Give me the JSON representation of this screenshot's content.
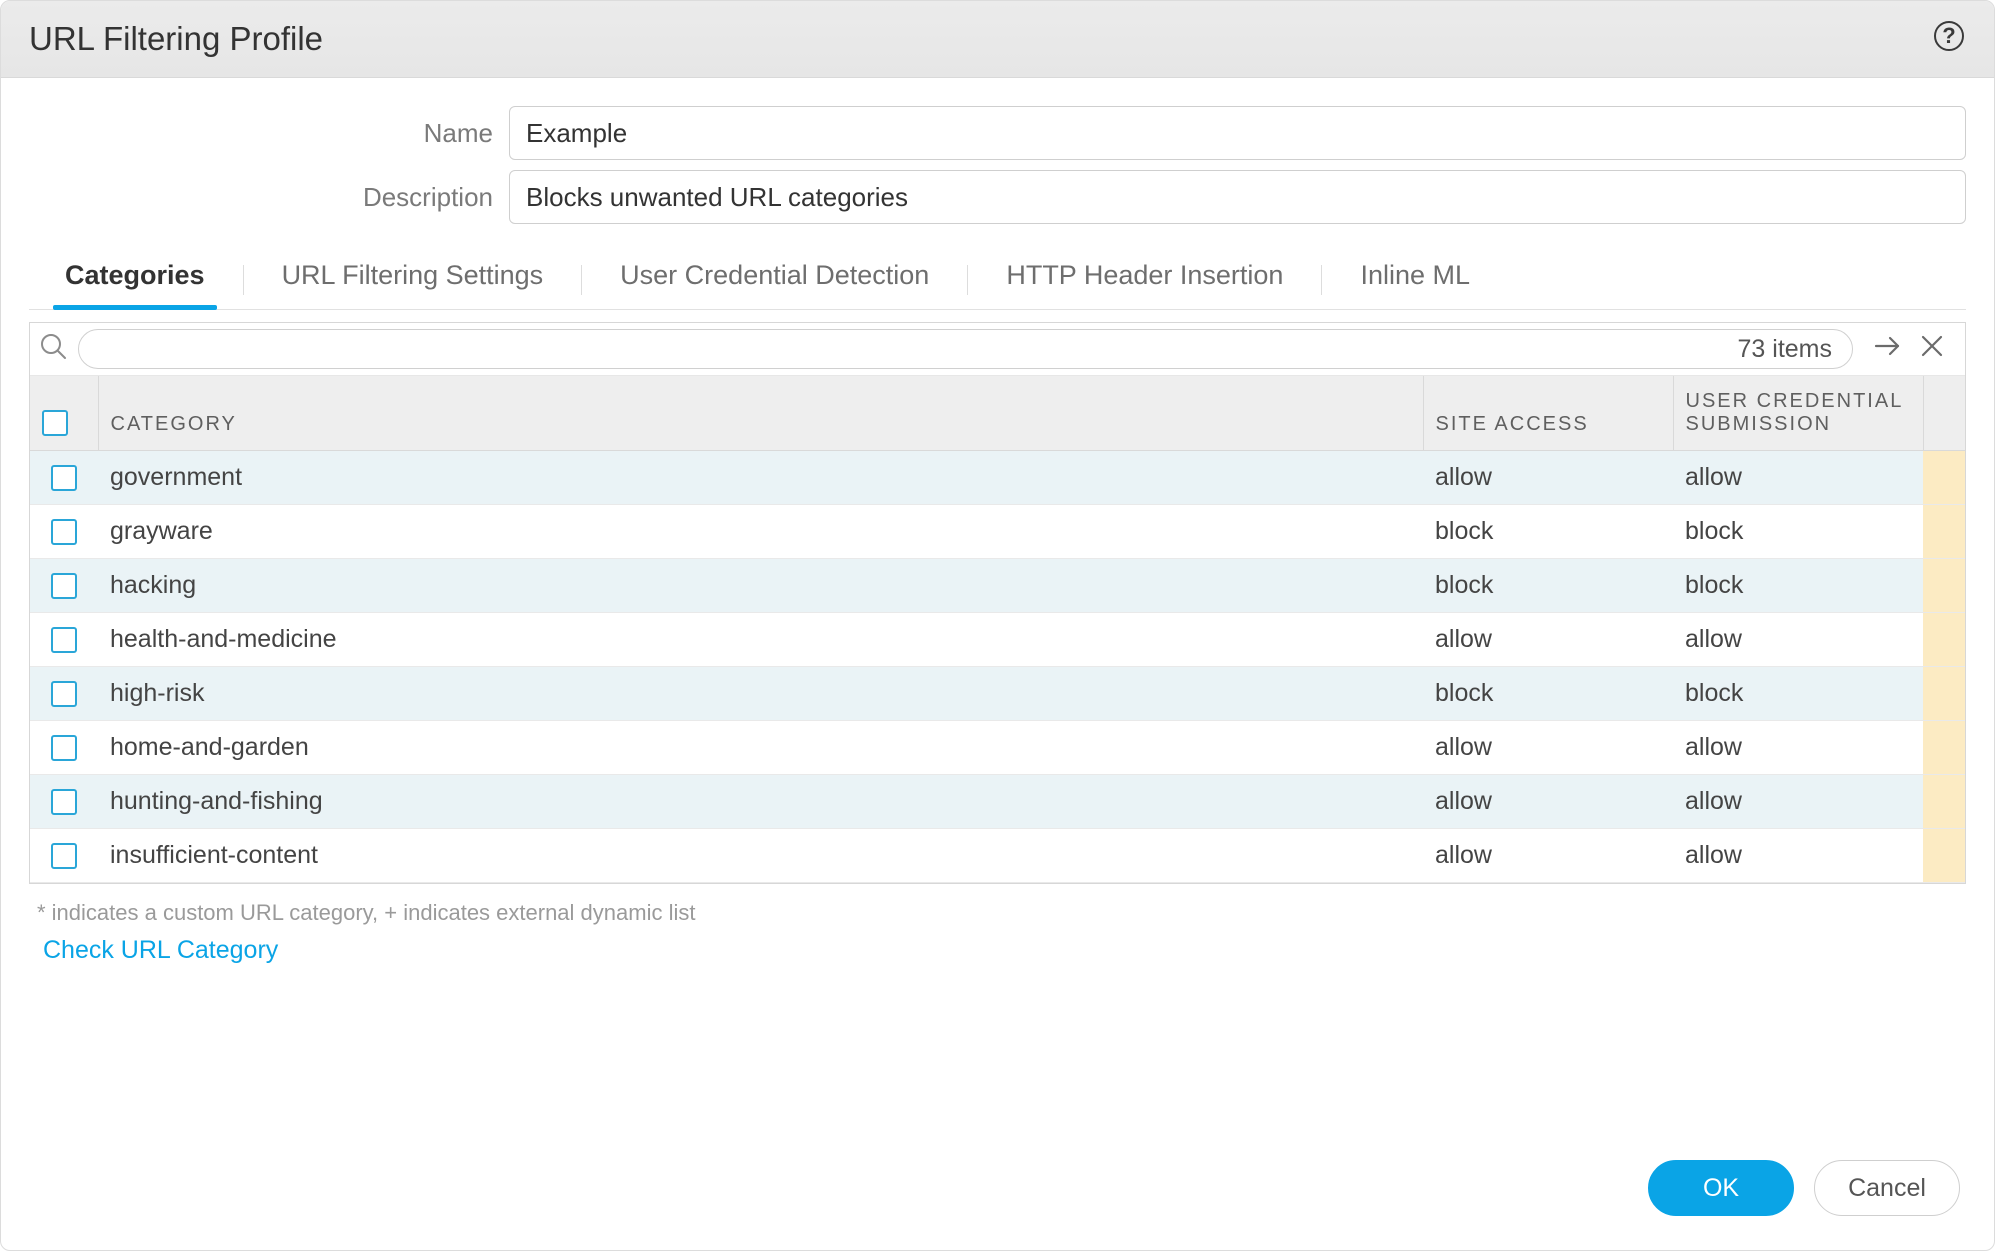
{
  "dialog": {
    "title": "URL Filtering Profile"
  },
  "form": {
    "name_label": "Name",
    "name_value": "Example",
    "desc_label": "Description",
    "desc_value": "Blocks unwanted URL categories"
  },
  "tabs": [
    {
      "label": "Categories"
    },
    {
      "label": "URL Filtering Settings"
    },
    {
      "label": "User Credential Detection"
    },
    {
      "label": "HTTP Header Insertion"
    },
    {
      "label": "Inline ML"
    }
  ],
  "grid": {
    "item_count": "73 items",
    "headers": {
      "category": "CATEGORY",
      "site_access": "SITE ACCESS",
      "user_cred": "USER CREDENTIAL SUBMISSION"
    },
    "rows": [
      {
        "category": "government",
        "site_access": "allow",
        "user_cred": "allow"
      },
      {
        "category": "grayware",
        "site_access": "block",
        "user_cred": "block"
      },
      {
        "category": "hacking",
        "site_access": "block",
        "user_cred": "block"
      },
      {
        "category": "health-and-medicine",
        "site_access": "allow",
        "user_cred": "allow"
      },
      {
        "category": "high-risk",
        "site_access": "block",
        "user_cred": "block"
      },
      {
        "category": "home-and-garden",
        "site_access": "allow",
        "user_cred": "allow"
      },
      {
        "category": "hunting-and-fishing",
        "site_access": "allow",
        "user_cred": "allow"
      },
      {
        "category": "insufficient-content",
        "site_access": "allow",
        "user_cred": "allow"
      }
    ]
  },
  "footnote": "* indicates a custom URL category, + indicates external dynamic list",
  "check_link": "Check URL Category",
  "buttons": {
    "ok": "OK",
    "cancel": "Cancel"
  }
}
